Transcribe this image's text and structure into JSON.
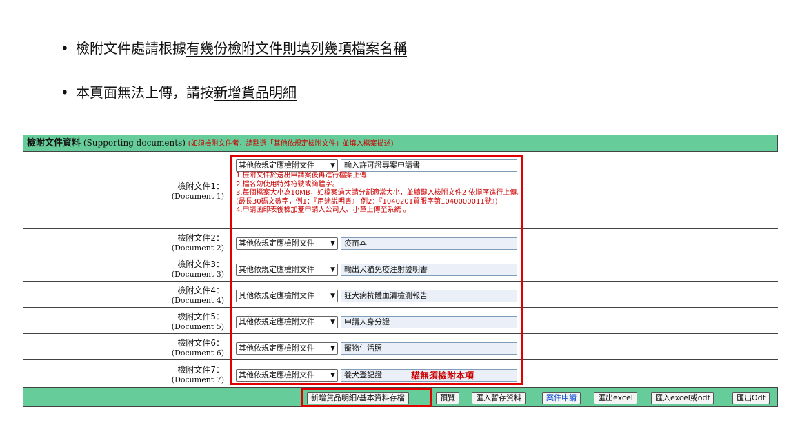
{
  "bullets": {
    "item1_prefix": "檢附文件處請根據",
    "item1_underlined": "有幾份檢附文件則填列幾項檔案名稱",
    "item2_prefix": "本頁面無法上傳，請按",
    "item2_underlined": "新增貨品明細"
  },
  "section": {
    "title": "檢附文件資料",
    "title_en": "(Supporting documents)",
    "hint": "(如須檢附文件者，請點選「其他依規定檢附文件」並填入檔案描述)"
  },
  "documents": [
    {
      "label": "檢附文件1：",
      "label_en": "(Document 1)",
      "type": "其他依規定應檢附文件",
      "description": "輸入許可證專案申請書"
    },
    {
      "label": "檢附文件2：",
      "label_en": "(Document 2)",
      "type": "其他依規定應檢附文件",
      "description": "疫苗本"
    },
    {
      "label": "檢附文件3：",
      "label_en": "(Document 3)",
      "type": "其他依規定應檢附文件",
      "description": "輸出犬貓免疫注射證明書"
    },
    {
      "label": "檢附文件4：",
      "label_en": "(Document 4)",
      "type": "其他依規定應檢附文件",
      "description": "狂犬病抗體血清檢測報告"
    },
    {
      "label": "檢附文件5：",
      "label_en": "(Document 5)",
      "type": "其他依規定應檢附文件",
      "description": "申請人身分證"
    },
    {
      "label": "檢附文件6：",
      "label_en": "(Document 6)",
      "type": "其他依規定應檢附文件",
      "description": "寵物生活照"
    },
    {
      "label": "檢附文件7：",
      "label_en": "(Document 7)",
      "type": "其他依規定應檢附文件",
      "description": "養犬登記證"
    }
  ],
  "notes": [
    "1.檢附文件於送出申請案後再進行檔案上傳!",
    "2.檔名勿使用特殊符號或簡體字。",
    "3.每個檔案大小為10MB，如檔案過大請分割適當大小，並續鍵入檢附文件2 依順序進行上傳。",
    "(最長30碼文數字，例1：『用途說明書』 例2：『1040201貿服字第1040000011號』)",
    "4.申請函印表後檢加蓋申請人公司大、小章上傳至系統 。"
  ],
  "doc7_annotation": "貓無須檢附本項",
  "buttons": {
    "add_goods": "新增貨品明細/基本資料存檔",
    "preview": "預覽",
    "import_draft": "匯入暫存資料",
    "submit_case": "案件申請",
    "export_excel": "匯出excel",
    "import_excel_odf": "匯入excel或odf",
    "export_odf": "匯出Odf"
  },
  "colors": {
    "header_bg": "#66cc99",
    "note_red": "#cc0000",
    "highlight_red": "#e00000",
    "submit_blue": "#0044cc"
  }
}
